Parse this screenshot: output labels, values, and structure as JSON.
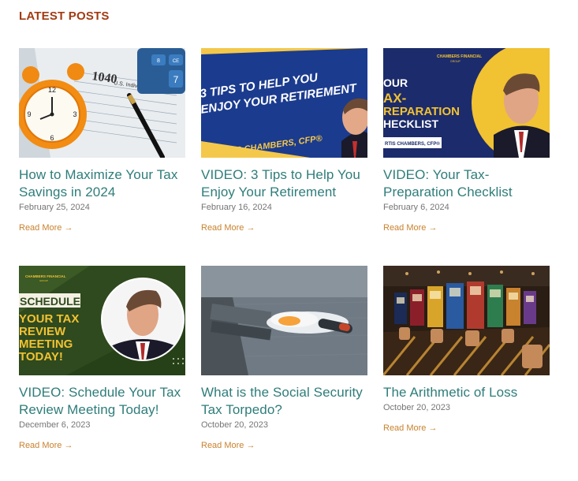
{
  "section_title": "LATEST POSTS",
  "read_more_label": "Read More",
  "arrow_icon": "arrow-right-icon",
  "colors": {
    "accent": "#a23b12",
    "title": "#2e7d7a",
    "link": "#c9822e",
    "date": "#757575"
  },
  "posts": [
    {
      "title": "How to Maximize Your Tax Savings in 2024",
      "date": "February 25, 2024",
      "thumb": {
        "form_number": "1040",
        "form_caption": "U.S. Individual Inc",
        "calc_key": "7",
        "calc_key2": "CE",
        "calc_key3": "8"
      }
    },
    {
      "title": "VIDEO: 3 Tips to Help You Enjoy Your Retirement",
      "date": "February 16, 2024",
      "thumb": {
        "line1": "3 TIPS TO HELP YOU",
        "line2": "ENJOY YOUR RETIREMENT",
        "name": "CURTIS CHAMBERS, CFP®"
      }
    },
    {
      "title": "VIDEO: Your Tax-Preparation Checklist",
      "date": "February 6, 2024",
      "thumb": {
        "brand": "CHAMBERS FINANCIAL",
        "brand_sub": "GROUP",
        "line1": "OUR",
        "line2": "AX-",
        "line3": "REPARATION",
        "line4": "HECKLIST",
        "name": "RTIS CHAMBERS, CFP®"
      }
    },
    {
      "title": "VIDEO: Schedule Your Tax Review Meeting Today!",
      "date": "December 6, 2023",
      "thumb": {
        "brand": "CHAMBERS FINANCIAL",
        "brand_sub": "GROUP",
        "line1": "SCHEDULE",
        "line2": "YOUR TAX",
        "line3": "REVIEW",
        "line4": "MEETING",
        "line5": "TODAY!"
      }
    },
    {
      "title": "What is the Social Security Tax Torpedo?",
      "date": "October 20, 2023",
      "thumb": {}
    },
    {
      "title": "The Arithmetic of Loss",
      "date": "October 20, 2023",
      "thumb": {}
    }
  ]
}
